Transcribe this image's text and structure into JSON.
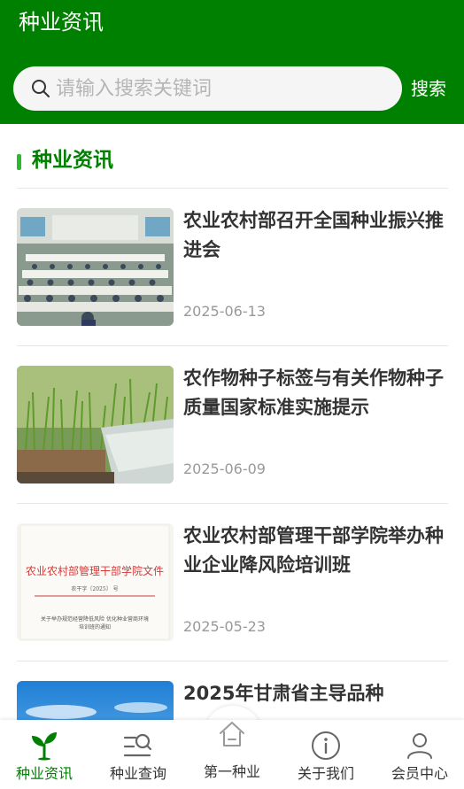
{
  "header": {
    "title": "种业资讯",
    "search_placeholder": "请输入搜索关键词",
    "search_button": "搜索"
  },
  "section": {
    "title": "种业资讯"
  },
  "news": [
    {
      "title": "农业农村部召开全国种业振兴推进会",
      "date": "2025-06-13",
      "thumb": "meeting-photo"
    },
    {
      "title": "农作物种子标签与有关作物种子质量国家标准实施提示",
      "date": "2025-06-09",
      "thumb": "seedling-photo"
    },
    {
      "title": "农业农村部管理干部学院举办种业企业降风险培训班",
      "date": "2025-05-23",
      "thumb": "document-photo",
      "thumb_text": {
        "header": "农业农村部管理干部学院文件",
        "number": "农干字〔2025〕 号",
        "subject_line1": "关于举办规范经营降低风险 优化种业营商环境",
        "subject_line2": "培训班的通知"
      }
    },
    {
      "title": "2025年甘肃省主导品种",
      "date": "",
      "thumb": "sky-photo"
    }
  ],
  "tabbar": {
    "items": [
      {
        "label": "种业资讯",
        "icon": "seedling-icon",
        "active": true
      },
      {
        "label": "种业查询",
        "icon": "search-list-icon",
        "active": false
      },
      {
        "label": "第一种业",
        "icon": "home-icon",
        "active": false
      },
      {
        "label": "关于我们",
        "icon": "info-icon",
        "active": false
      },
      {
        "label": "会员中心",
        "icon": "user-icon",
        "active": false
      }
    ]
  },
  "colors": {
    "brand": "#008000",
    "accent_bar": "#2eb82e",
    "text_primary": "#333333",
    "text_muted": "#999999"
  }
}
